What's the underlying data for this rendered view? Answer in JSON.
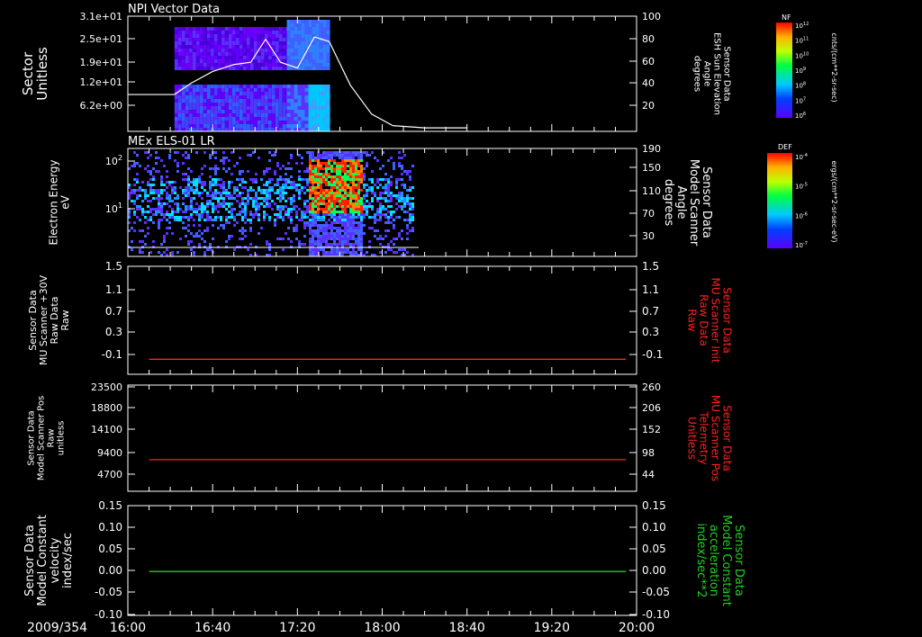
{
  "colors": {
    "bg": "#000000",
    "axis": "#ffffff",
    "red": "#ff2020",
    "green": "#20d020"
  },
  "time_axis": {
    "date": "2009/354",
    "ticks": [
      "16:00",
      "16:40",
      "17:20",
      "18:00",
      "18:40",
      "19:20",
      "20:00"
    ]
  },
  "chart_data": [
    {
      "type": "heatmap",
      "title": "NPI Vector Data",
      "ylabel": "Sector\nUnitless",
      "y_ticks": [
        "3.1e+01",
        "2.5e+01",
        "1.9e+01",
        "1.2e+01",
        "6.2e+00"
      ],
      "y2label": "Sensor Data\nESH Sun Elevation\nAngle\ndegrees",
      "y2_ticks": [
        "100",
        "80",
        "60",
        "40",
        "20"
      ],
      "y2lim": [
        0,
        100
      ],
      "colorbar": {
        "label": "NF",
        "units": "cnts/(cm**2-sr-sec)",
        "ticks": [
          "10^12",
          "10^11",
          "10^10",
          "10^9",
          "10^8",
          "10^7",
          "10^6"
        ]
      },
      "data_coverage": {
        "start": "16:22",
        "end": "17:35"
      },
      "overlay_line": {
        "name": "ESH Sun Elevation Angle",
        "x": [
          "16:00",
          "16:22",
          "16:30",
          "16:40",
          "16:50",
          "16:58",
          "17:05",
          "17:12",
          "17:20",
          "17:28",
          "17:35",
          "17:45",
          "17:55",
          "18:05",
          "18:20",
          "18:40"
        ],
        "y": [
          32,
          32,
          42,
          52,
          58,
          60,
          80,
          60,
          55,
          82,
          78,
          40,
          15,
          5,
          3,
          3
        ]
      }
    },
    {
      "type": "heatmap",
      "title": "MEx ELS-01 LR",
      "ylabel": "Electron Energy\neV",
      "y_ticks": [
        "10^2",
        "10^1"
      ],
      "y2label": "Sensor Data\nModel Scanner\nAngle\ndegrees",
      "y2_ticks": [
        "190",
        "150",
        "110",
        "70",
        "30"
      ],
      "colorbar": {
        "label": "DEF",
        "units": "ergs/(cm**2-sr-sec-eV)",
        "ticks": [
          "10^-4",
          "10^-5",
          "10^-6",
          "10^-7"
        ]
      },
      "data_coverage": {
        "start": "16:00",
        "end": "18:15"
      },
      "overlay_line": {
        "name": "Model Scanner Angle",
        "x": [
          "16:00",
          "18:15"
        ],
        "y": [
          10,
          10
        ]
      }
    },
    {
      "type": "line",
      "ylabel": "Sensor Data\nMU Scanner +30V\nRaw Data\nRaw",
      "y_ticks": [
        "1.5",
        "1.1",
        "0.7",
        "0.3",
        "-0.1"
      ],
      "ylim": [
        -0.3,
        1.5
      ],
      "y2label": "Sensor Data\nMU Scanner Init\nRaw Data\nRaw",
      "y2_ticks": [
        "1.5",
        "1.1",
        "0.7",
        "0.3",
        "-0.1"
      ],
      "series": [
        {
          "x": [
            "16:10",
            "19:55"
          ],
          "values": [
            -0.05,
            -0.05
          ],
          "color": "#ff2020"
        }
      ]
    },
    {
      "type": "line",
      "ylabel": "Sensor Data\nModel Scanner Pos\nRaw\nunitless",
      "y_ticks": [
        "23500",
        "18800",
        "14100",
        "9400",
        "4700"
      ],
      "ylim": [
        0,
        23500
      ],
      "y2label": "Sensor Data\nMU Scanner Pos\nTelemetry\nUnitless",
      "y2_ticks": [
        "260",
        "206",
        "152",
        "98",
        "44"
      ],
      "series": [
        {
          "x": [
            "16:10",
            "19:55"
          ],
          "values": [
            7000,
            7000
          ],
          "color": "#ff2020"
        }
      ]
    },
    {
      "type": "line",
      "ylabel": "Sensor Data\nModel Constant\nvelocity\nindex/sec",
      "y_ticks": [
        "0.15",
        "0.10",
        "0.05",
        "0.00",
        "-0.05",
        "-0.10"
      ],
      "ylim": [
        -0.1,
        0.15
      ],
      "y2label": "Sensor Data\nModel Constant\nacceleration\nindex/sec**2",
      "y2_ticks": [
        "0.15",
        "0.10",
        "0.05",
        "0.00",
        "-0.05",
        "-0.10"
      ],
      "series": [
        {
          "x": [
            "16:10",
            "19:55"
          ],
          "values": [
            0,
            0
          ],
          "color": "#20d020"
        }
      ]
    }
  ]
}
